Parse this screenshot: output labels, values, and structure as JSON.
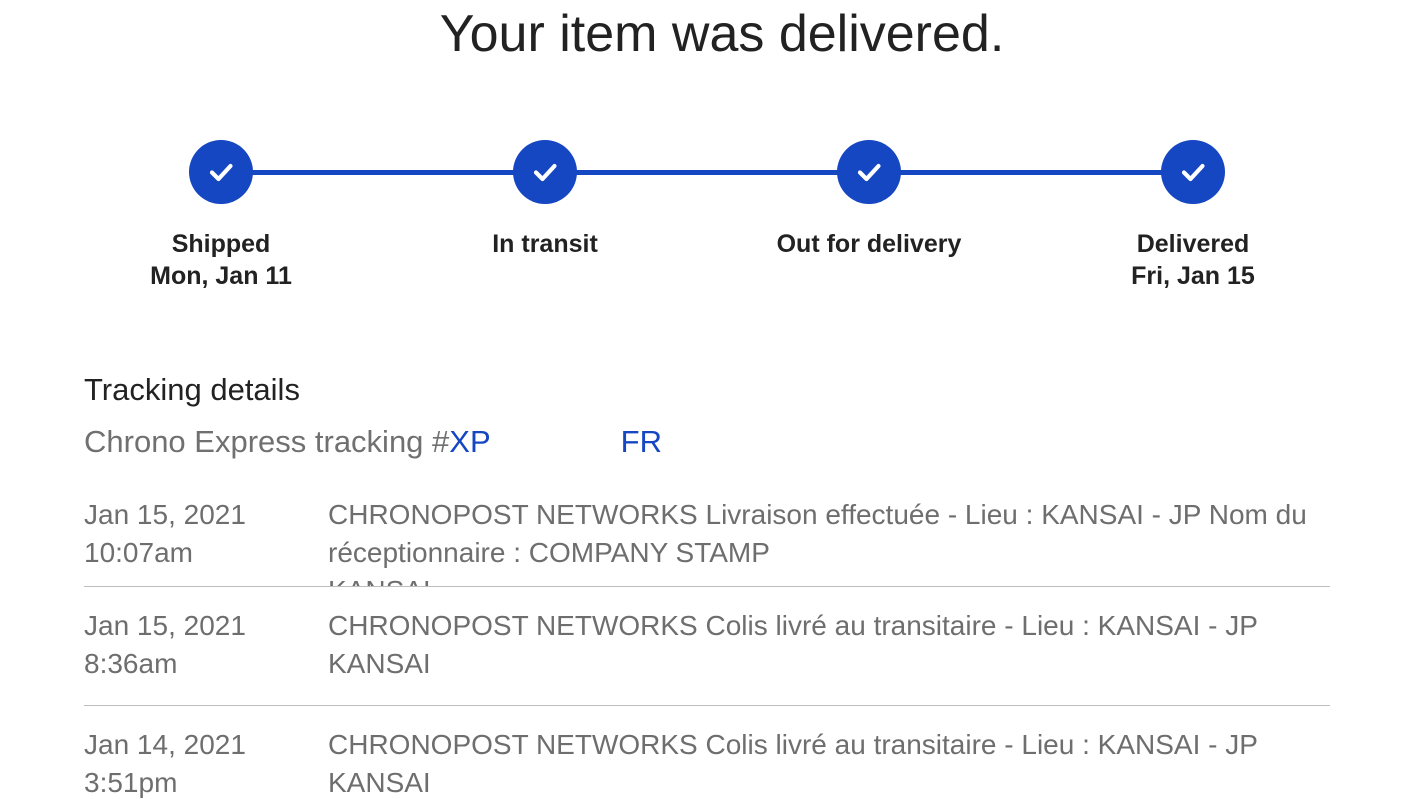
{
  "header": {
    "title": "Your item was delivered."
  },
  "progress": {
    "steps": [
      {
        "label": "Shipped",
        "date": "Mon, Jan 11",
        "status": "complete",
        "icon": "checkmark-icon"
      },
      {
        "label": "In transit",
        "date": "",
        "status": "complete",
        "icon": "checkmark-icon"
      },
      {
        "label": "Out for delivery",
        "date": "",
        "status": "complete",
        "icon": "checkmark-icon"
      },
      {
        "label": "Delivered",
        "date": "Fri, Jan 15",
        "status": "complete",
        "icon": "checkmark-icon"
      }
    ],
    "accent_color": "#1547c2"
  },
  "tracking": {
    "section_title": "Tracking details",
    "carrier_prefix": "Chrono Express tracking #",
    "number_start": "XP",
    "number_end": "FR"
  },
  "events": [
    {
      "date": "Jan 15, 2021",
      "time": "10:07am",
      "description": "CHRONOPOST NETWORKS Livraison effectuée - Lieu : KANSAI - JP Nom du réceptionnaire : COMPANY STAMP",
      "location": "KANSAI"
    },
    {
      "date": "Jan 15, 2021",
      "time": "8:36am",
      "description": "CHRONOPOST NETWORKS Colis livré au transitaire - Lieu : KANSAI - JP",
      "location": "KANSAI"
    },
    {
      "date": "Jan 14, 2021",
      "time": "3:51pm",
      "description": "CHRONOPOST NETWORKS Colis livré au transitaire - Lieu : KANSAI - JP",
      "location": "KANSAI"
    }
  ]
}
